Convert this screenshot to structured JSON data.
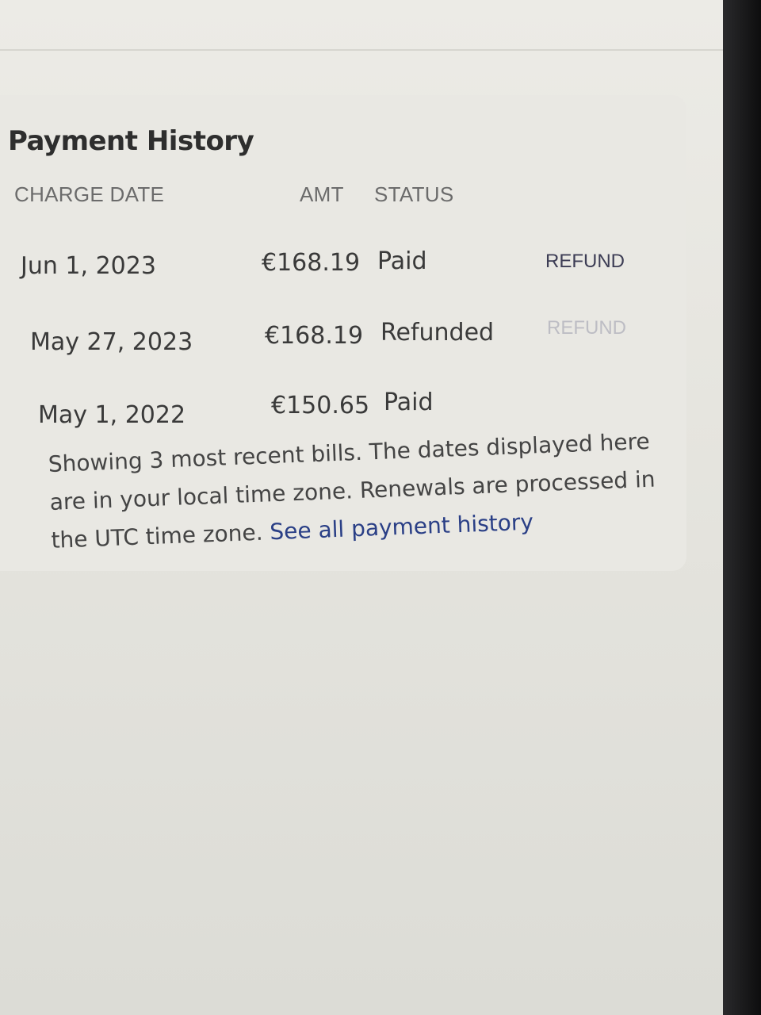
{
  "payment_history": {
    "title": "Payment History",
    "columns": {
      "charge_date": "CHARGE DATE",
      "amount": "AMT",
      "status": "STATUS"
    },
    "rows": [
      {
        "date": "Jun 1, 2023",
        "amount": "€168.19",
        "status": "Paid",
        "action": "REFUND",
        "action_enabled": true
      },
      {
        "date": "May 27, 2023",
        "amount": "€168.19",
        "status": "Refunded",
        "action": "REFUND",
        "action_enabled": false
      },
      {
        "date": "May 1, 2022",
        "amount": "€150.65",
        "status": "Paid",
        "action": "",
        "action_enabled": false
      }
    ],
    "note_text": "Showing 3 most recent bills. The dates displayed here are in your local time zone. Renewals are processed in the UTC time zone. ",
    "note_link": "See all payment history"
  },
  "colors": {
    "link": "#2a3f86",
    "text": "#3a3a3a",
    "muted": "#6b6b6b",
    "disabled": "#bdbdc4"
  }
}
